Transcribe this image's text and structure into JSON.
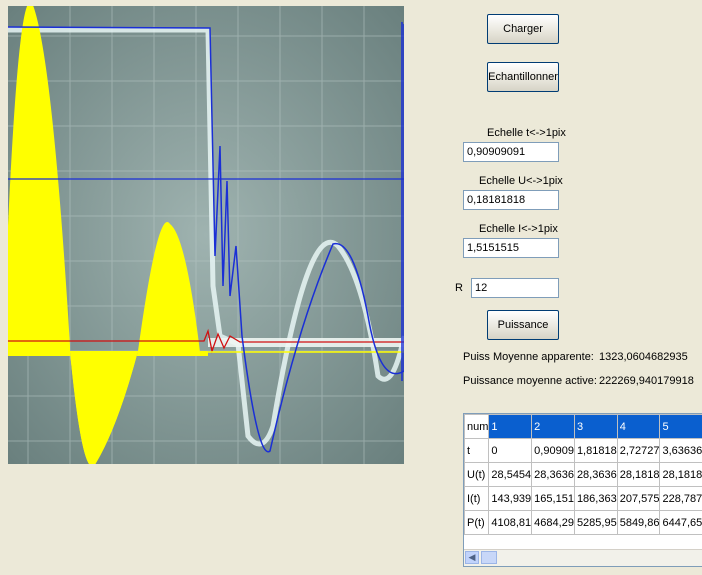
{
  "buttons": {
    "charger": "Charger",
    "echantillonner": "Echantillonner",
    "puissance": "Puissance"
  },
  "fields": {
    "echelle_t": {
      "label": "Echelle t<->1pix",
      "value": "0,90909091"
    },
    "echelle_u": {
      "label": "Echelle U<->1pix",
      "value": "0,18181818"
    },
    "echelle_i": {
      "label": "Echelle I<->1pix",
      "value": "1,5151515"
    },
    "r": {
      "label": "R",
      "value": "12"
    }
  },
  "results": {
    "apparente_label": "Puiss Moyenne apparente:",
    "apparente_value": "1323,0604682935",
    "active_label": "Puissance moyenne active:",
    "active_value": "222269,940179918"
  },
  "grid": {
    "header": [
      "num",
      "1",
      "2",
      "3",
      "4",
      "5"
    ],
    "rows": [
      {
        "label": "t",
        "cells": [
          "0",
          "0,90909",
          "1,81818",
          "2,72727",
          "3,63636"
        ]
      },
      {
        "label": "U(t)",
        "cells": [
          "28,5454",
          "28,3636",
          "28,3636",
          "28,1818",
          "28,1818"
        ]
      },
      {
        "label": "I(t)",
        "cells": [
          "143,939",
          "165,151",
          "186,363",
          "207,575",
          "228,787"
        ]
      },
      {
        "label": "P(t)",
        "cells": [
          "4108,81",
          "4684,29",
          "5285,95",
          "5849,86",
          "6447,65"
        ]
      }
    ],
    "scroll_left_icon": "scroll-left-arrow-icon"
  },
  "colors": {
    "scope_bg": "#7e9391",
    "trace_blue": "#1a2fd6",
    "trace_yellow": "#ffff00",
    "trace_red": "#d01010",
    "header_blue": "#0a5fcf"
  }
}
